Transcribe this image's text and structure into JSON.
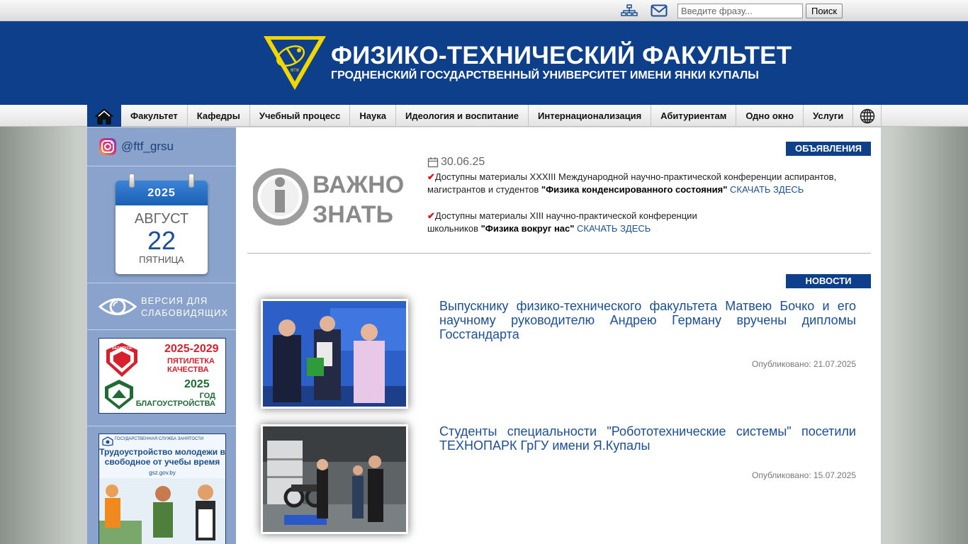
{
  "topbar": {
    "search_placeholder": "Введите фразу...",
    "search_button": "Поиск",
    "icons": [
      "sitemap-icon",
      "mail-icon"
    ]
  },
  "header": {
    "logo_text": "ФТФ",
    "title": "ФИЗИКО-ТЕХНИЧЕСКИЙ ФАКУЛЬТЕТ",
    "subtitle": "ГРОДНЕНСКИЙ ГОСУДАРСТВЕННЫЙ УНИВЕРСИТЕТ ИМЕНИ ЯНКИ КУПАЛЫ"
  },
  "nav": {
    "items": [
      "Факультет",
      "Кафедры",
      "Учебный процесс",
      "Наука",
      "Идеология и воспитание",
      "Интернационализация",
      "Абитуриентам",
      "Одно окно",
      "Услуги"
    ]
  },
  "sidebar": {
    "instagram_handle": "@ftf_grsu",
    "calendar": {
      "year": "2025",
      "month": "АВГУСТ",
      "day": "22",
      "weekday": "ПЯТНИЦА"
    },
    "accessibility": {
      "line1": "ВЕРСИЯ ДЛЯ",
      "line2": "СЛАБОВИДЯЩИХ"
    },
    "banner1": {
      "badge": "БЕЛАРУСЬ",
      "years": "2025-2029",
      "text1": "ПЯТИЛЕТКА",
      "text1b": "КАЧЕСТВА",
      "year2": "2025",
      "text2": "ГОД",
      "text2b": "БЛАГОУСТРОЙСТВА"
    },
    "banner2": {
      "org": "ГОСУДАРСТВЕННАЯ СЛУЖБА ЗАНЯТОСТИ",
      "headline": "Трудоустройство молодежи в свободное от учебы время",
      "url": "gsz.gov.by"
    }
  },
  "announcements": {
    "label": "ОБЪЯВЛЕНИЯ",
    "image_text_1": "ВАЖНО",
    "image_text_2": "ЗНАТЬ",
    "date": "30.06.25",
    "items": [
      {
        "text": "Доступны материалы XXXIII Международной научно-практической конференции аспирантов, магистрантов и студентов ",
        "bold": "\"Физика конденсированного состояния\"",
        "link": "СКАЧАТЬ ЗДЕСЬ"
      },
      {
        "text": "Доступны материалы XIII научно-практической конференции школьников ",
        "bold": "\"Физика вокруг нас\"",
        "link": "СКАЧАТЬ ЗДЕСЬ"
      }
    ]
  },
  "news": {
    "label": "НОВОСТИ",
    "items": [
      {
        "title": "Выпускнику физико-технического факультета Матвею Бочко и его научному руководителю Андрею Герману вручены дипломы Госстандарта",
        "date": "Опубликовано: 21.07.2025"
      },
      {
        "title": "Студенты специальности \"Робототехнические системы\" посетили ТЕХНОПАРК ГрГУ имени Я.Купалы",
        "date": "Опубликовано: 15.07.2025"
      }
    ]
  },
  "colors": {
    "brand": "#0e3f8a",
    "sidebar": "#8aa3cc",
    "link": "#1a5296",
    "check": "#e01010"
  }
}
